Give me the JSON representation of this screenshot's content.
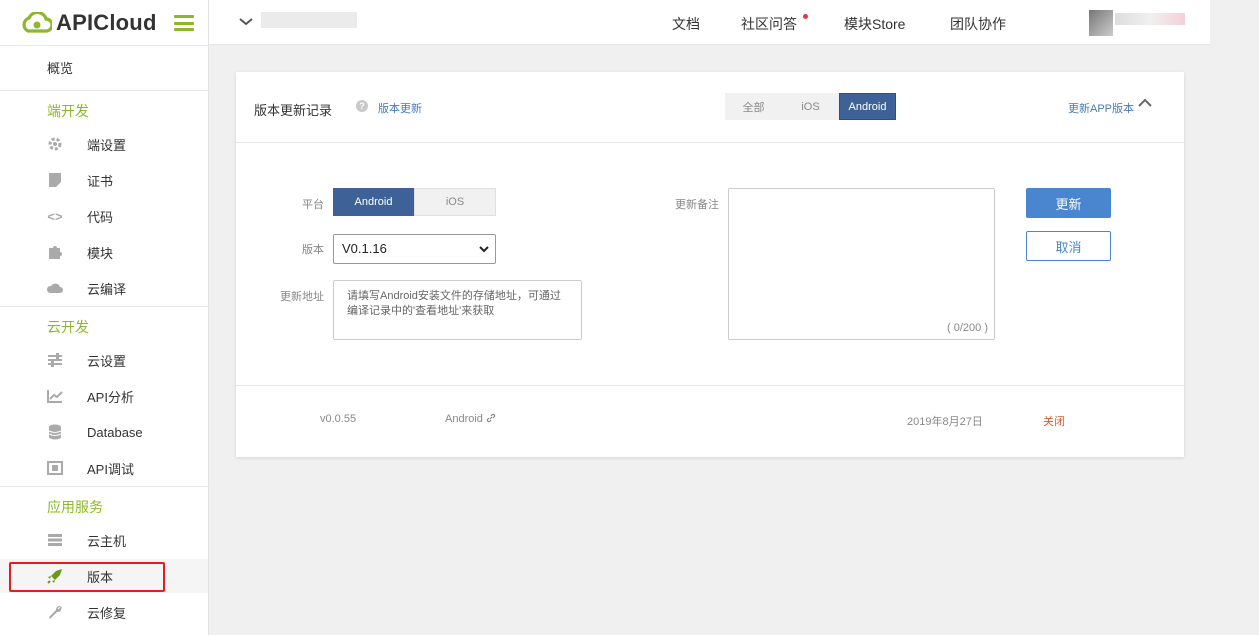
{
  "brand": {
    "logo_text": "APICloud",
    "accent": "#8cb82a"
  },
  "topbar": {
    "nav": [
      "文档",
      "社区问答",
      "模块Store",
      "团队协作"
    ]
  },
  "sidebar": {
    "overview": "概览",
    "sections": [
      {
        "title": "端开发",
        "items": [
          {
            "label": "端设置",
            "icon": "gear-icon"
          },
          {
            "label": "证书",
            "icon": "certificate-icon"
          },
          {
            "label": "代码",
            "icon": "code-icon"
          },
          {
            "label": "模块",
            "icon": "puzzle-icon"
          },
          {
            "label": "云编译",
            "icon": "cloud-icon"
          }
        ]
      },
      {
        "title": "云开发",
        "items": [
          {
            "label": "云设置",
            "icon": "sliders-icon"
          },
          {
            "label": "API分析",
            "icon": "chart-icon"
          },
          {
            "label": "Database",
            "icon": "database-icon"
          },
          {
            "label": "API调试",
            "icon": "debug-icon"
          }
        ]
      },
      {
        "title": "应用服务",
        "items": [
          {
            "label": "云主机",
            "icon": "server-icon"
          },
          {
            "label": "版本",
            "icon": "rocket-icon",
            "active": true
          },
          {
            "label": "云修复",
            "icon": "wrench-icon"
          }
        ]
      }
    ]
  },
  "card": {
    "title": "版本更新记录",
    "help_link": "版本更新",
    "filter_tabs": [
      "全部",
      "iOS",
      "Android"
    ],
    "active_filter": "Android",
    "update_app_link": "更新APP版本"
  },
  "form": {
    "platform_label": "平台",
    "platform_options": [
      "Android",
      "iOS"
    ],
    "platform_selected": "Android",
    "version_label": "版本",
    "version_value": "V0.1.16",
    "address_label": "更新地址",
    "address_placeholder": "请填写Android安装文件的存储地址，可通过编译记录中的'查看地址'来获取",
    "note_label": "更新备注",
    "note_count": "( 0/200 )",
    "submit": "更新",
    "cancel": "取消"
  },
  "records": [
    {
      "version": "v0.0.55",
      "platform": "Android",
      "date": "2019年8月27日",
      "action": "关闭"
    }
  ]
}
